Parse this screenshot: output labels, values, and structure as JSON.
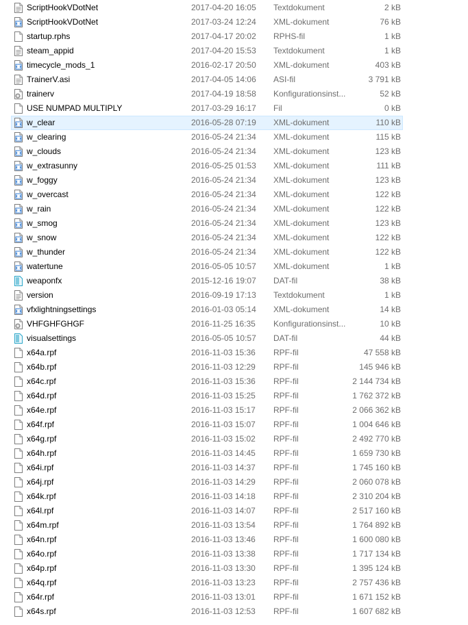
{
  "files": [
    {
      "name": "ScriptHookVDotNet",
      "date": "2017-04-20 16:05",
      "type": "Textdokument",
      "size": "2 kB",
      "icon": "text-file-icon"
    },
    {
      "name": "ScriptHookVDotNet",
      "date": "2017-03-24 12:24",
      "type": "XML-dokument",
      "size": "76 kB",
      "icon": "xml-file-icon"
    },
    {
      "name": "startup.rphs",
      "date": "2017-04-17 20:02",
      "type": "RPHS-fil",
      "size": "1 kB",
      "icon": "blank-file-icon"
    },
    {
      "name": "steam_appid",
      "date": "2017-04-20 15:53",
      "type": "Textdokument",
      "size": "1 kB",
      "icon": "text-file-icon"
    },
    {
      "name": "timecycle_mods_1",
      "date": "2016-02-17 20:50",
      "type": "XML-dokument",
      "size": "403 kB",
      "icon": "xml-file-icon"
    },
    {
      "name": "TrainerV.asi",
      "date": "2017-04-05 14:06",
      "type": "ASI-fil",
      "size": "3 791 kB",
      "icon": "text-file-icon"
    },
    {
      "name": "trainerv",
      "date": "2017-04-19 18:58",
      "type": "Konfigurationsinst...",
      "size": "52 kB",
      "icon": "config-file-icon"
    },
    {
      "name": "USE NUMPAD MULTIPLY",
      "date": "2017-03-29 16:17",
      "type": "Fil",
      "size": "0 kB",
      "icon": "blank-file-icon"
    },
    {
      "name": "w_clear",
      "date": "2016-05-28 07:19",
      "type": "XML-dokument",
      "size": "110 kB",
      "icon": "xml-file-icon",
      "selected": true
    },
    {
      "name": "w_clearing",
      "date": "2016-05-24 21:34",
      "type": "XML-dokument",
      "size": "115 kB",
      "icon": "xml-file-icon"
    },
    {
      "name": "w_clouds",
      "date": "2016-05-24 21:34",
      "type": "XML-dokument",
      "size": "123 kB",
      "icon": "xml-file-icon"
    },
    {
      "name": "w_extrasunny",
      "date": "2016-05-25 01:53",
      "type": "XML-dokument",
      "size": "111 kB",
      "icon": "xml-file-icon"
    },
    {
      "name": "w_foggy",
      "date": "2016-05-24 21:34",
      "type": "XML-dokument",
      "size": "123 kB",
      "icon": "xml-file-icon"
    },
    {
      "name": "w_overcast",
      "date": "2016-05-24 21:34",
      "type": "XML-dokument",
      "size": "122 kB",
      "icon": "xml-file-icon"
    },
    {
      "name": "w_rain",
      "date": "2016-05-24 21:34",
      "type": "XML-dokument",
      "size": "122 kB",
      "icon": "xml-file-icon"
    },
    {
      "name": "w_smog",
      "date": "2016-05-24 21:34",
      "type": "XML-dokument",
      "size": "123 kB",
      "icon": "xml-file-icon"
    },
    {
      "name": "w_snow",
      "date": "2016-05-24 21:34",
      "type": "XML-dokument",
      "size": "122 kB",
      "icon": "xml-file-icon"
    },
    {
      "name": "w_thunder",
      "date": "2016-05-24 21:34",
      "type": "XML-dokument",
      "size": "122 kB",
      "icon": "xml-file-icon"
    },
    {
      "name": "watertune",
      "date": "2016-05-05 10:57",
      "type": "XML-dokument",
      "size": "1 kB",
      "icon": "xml-file-icon"
    },
    {
      "name": "weaponfx",
      "date": "2015-12-16 19:07",
      "type": "DAT-fil",
      "size": "38 kB",
      "icon": "dat-file-icon"
    },
    {
      "name": "version",
      "date": "2016-09-19 17:13",
      "type": "Textdokument",
      "size": "1 kB",
      "icon": "text-file-icon"
    },
    {
      "name": "vfxlightningsettings",
      "date": "2016-01-03 05:14",
      "type": "XML-dokument",
      "size": "14 kB",
      "icon": "xml-file-icon"
    },
    {
      "name": "VHFGHFGHGF",
      "date": "2016-11-25 16:35",
      "type": "Konfigurationsinst...",
      "size": "10 kB",
      "icon": "config-file-icon"
    },
    {
      "name": "visualsettings",
      "date": "2016-05-05 10:57",
      "type": "DAT-fil",
      "size": "44 kB",
      "icon": "dat-file-icon"
    },
    {
      "name": "x64a.rpf",
      "date": "2016-11-03 15:36",
      "type": "RPF-fil",
      "size": "47 558 kB",
      "icon": "blank-file-icon"
    },
    {
      "name": "x64b.rpf",
      "date": "2016-11-03 12:29",
      "type": "RPF-fil",
      "size": "145 946 kB",
      "icon": "blank-file-icon"
    },
    {
      "name": "x64c.rpf",
      "date": "2016-11-03 15:36",
      "type": "RPF-fil",
      "size": "2 144 734 kB",
      "icon": "blank-file-icon"
    },
    {
      "name": "x64d.rpf",
      "date": "2016-11-03 15:25",
      "type": "RPF-fil",
      "size": "1 762 372 kB",
      "icon": "blank-file-icon"
    },
    {
      "name": "x64e.rpf",
      "date": "2016-11-03 15:17",
      "type": "RPF-fil",
      "size": "2 066 362 kB",
      "icon": "blank-file-icon"
    },
    {
      "name": "x64f.rpf",
      "date": "2016-11-03 15:07",
      "type": "RPF-fil",
      "size": "1 004 646 kB",
      "icon": "blank-file-icon"
    },
    {
      "name": "x64g.rpf",
      "date": "2016-11-03 15:02",
      "type": "RPF-fil",
      "size": "2 492 770 kB",
      "icon": "blank-file-icon"
    },
    {
      "name": "x64h.rpf",
      "date": "2016-11-03 14:45",
      "type": "RPF-fil",
      "size": "1 659 730 kB",
      "icon": "blank-file-icon"
    },
    {
      "name": "x64i.rpf",
      "date": "2016-11-03 14:37",
      "type": "RPF-fil",
      "size": "1 745 160 kB",
      "icon": "blank-file-icon"
    },
    {
      "name": "x64j.rpf",
      "date": "2016-11-03 14:29",
      "type": "RPF-fil",
      "size": "2 060 078 kB",
      "icon": "blank-file-icon"
    },
    {
      "name": "x64k.rpf",
      "date": "2016-11-03 14:18",
      "type": "RPF-fil",
      "size": "2 310 204 kB",
      "icon": "blank-file-icon"
    },
    {
      "name": "x64l.rpf",
      "date": "2016-11-03 14:07",
      "type": "RPF-fil",
      "size": "2 517 160 kB",
      "icon": "blank-file-icon"
    },
    {
      "name": "x64m.rpf",
      "date": "2016-11-03 13:54",
      "type": "RPF-fil",
      "size": "1 764 892 kB",
      "icon": "blank-file-icon"
    },
    {
      "name": "x64n.rpf",
      "date": "2016-11-03 13:46",
      "type": "RPF-fil",
      "size": "1 600 080 kB",
      "icon": "blank-file-icon"
    },
    {
      "name": "x64o.rpf",
      "date": "2016-11-03 13:38",
      "type": "RPF-fil",
      "size": "1 717 134 kB",
      "icon": "blank-file-icon"
    },
    {
      "name": "x64p.rpf",
      "date": "2016-11-03 13:30",
      "type": "RPF-fil",
      "size": "1 395 124 kB",
      "icon": "blank-file-icon"
    },
    {
      "name": "x64q.rpf",
      "date": "2016-11-03 13:23",
      "type": "RPF-fil",
      "size": "2 757 436 kB",
      "icon": "blank-file-icon"
    },
    {
      "name": "x64r.rpf",
      "date": "2016-11-03 13:01",
      "type": "RPF-fil",
      "size": "1 671 152 kB",
      "icon": "blank-file-icon"
    },
    {
      "name": "x64s.rpf",
      "date": "2016-11-03 12:53",
      "type": "RPF-fil",
      "size": "1 607 682 kB",
      "icon": "blank-file-icon"
    }
  ],
  "colors": {
    "selection_bg": "#e5f3ff",
    "selection_border": "#cce8ff",
    "secondary_text": "#6d6d6d",
    "xml_accent": "#2f7bd4",
    "dat_accent": "#2aa6c8",
    "config_accent": "#7a7a7a"
  }
}
